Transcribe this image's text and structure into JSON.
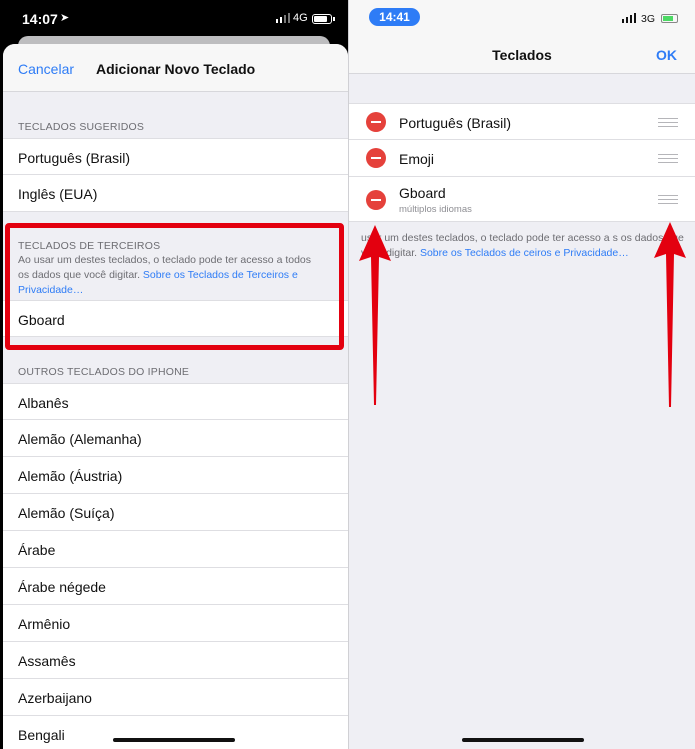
{
  "left": {
    "status": {
      "time": "14:07",
      "network": "4G"
    },
    "nav": {
      "cancel": "Cancelar",
      "title": "Adicionar Novo Teclado"
    },
    "suggested": {
      "header": "TECLADOS SUGERIDOS",
      "items": [
        "Português (Brasil)",
        "Inglês (EUA)"
      ]
    },
    "third_party": {
      "header": "TECLADOS DE TERCEIROS",
      "note": "Ao usar um destes teclados, o teclado pode ter acesso a todos os dados que você digitar. ",
      "link": "Sobre os Teclados de Terceiros e Privacidade…",
      "items": [
        "Gboard"
      ]
    },
    "others": {
      "header": "OUTROS TECLADOS DO IPHONE",
      "items": [
        "Albanês",
        "Alemão (Alemanha)",
        "Alemão (Áustria)",
        "Alemão (Suíça)",
        "Árabe",
        "Árabe négede",
        "Armênio",
        "Assamês",
        "Azerbaijano",
        "Bengali"
      ]
    }
  },
  "right": {
    "status": {
      "time": "14:41",
      "network": "3G"
    },
    "nav": {
      "title": "Teclados",
      "ok": "OK"
    },
    "keyboards": [
      {
        "name": "Português (Brasil)",
        "sub": ""
      },
      {
        "name": "Emoji",
        "sub": ""
      },
      {
        "name": "Gboard",
        "sub": "múltiplos idiomas"
      }
    ],
    "note": "usar um destes teclados, o teclado pode ter acesso a s os dados que você digitar. ",
    "link": "Sobre os Teclados de ceiros e Privacidade…"
  },
  "colors": {
    "accent": "#2e7cf6",
    "delete": "#e5413b",
    "highlight": "#e3000f",
    "arrow": "#e3000f"
  },
  "icons": [
    "location-arrow-icon",
    "signal-icon",
    "battery-icon",
    "delete-minus-icon",
    "drag-handle-icon",
    "arrow-up-icon"
  ]
}
